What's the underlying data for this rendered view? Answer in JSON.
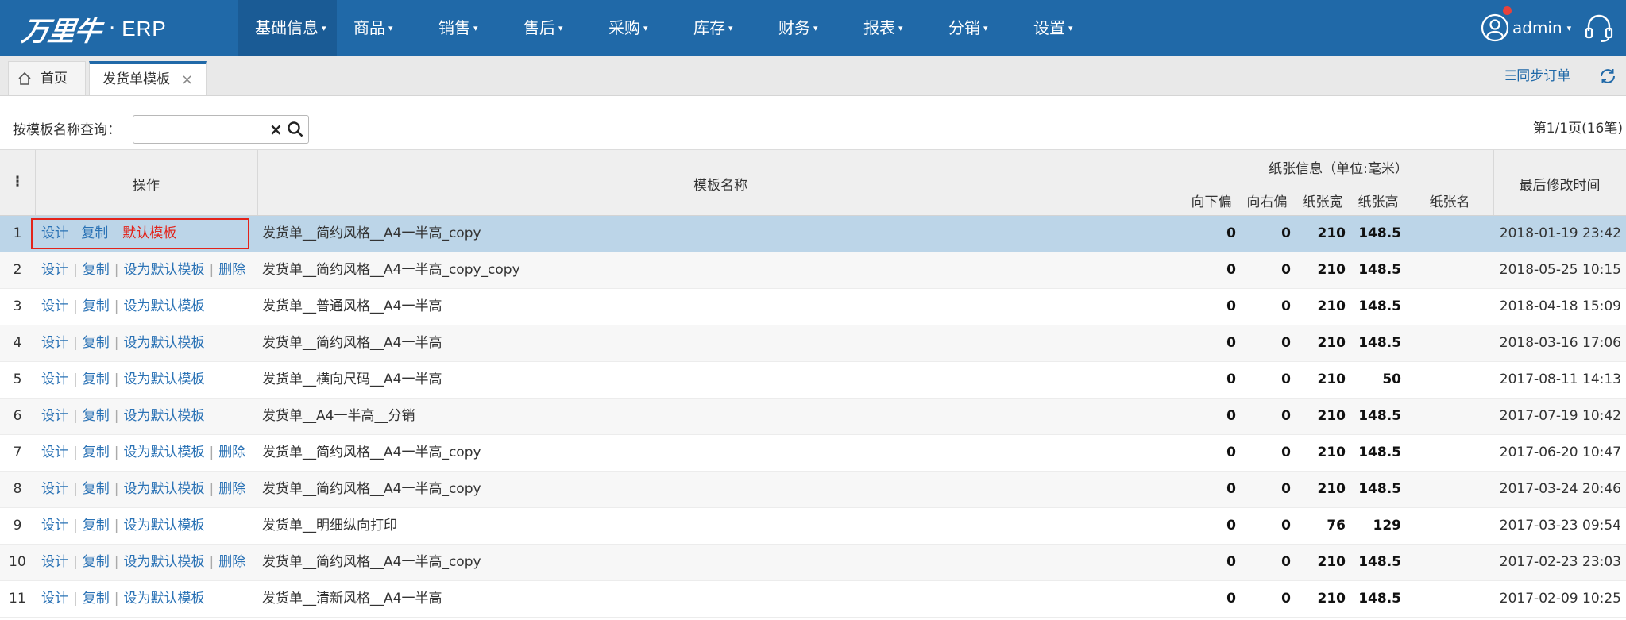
{
  "app": {
    "logo_text": "万里牛",
    "logo_dot": "·",
    "product": "ERP"
  },
  "nav": {
    "items": [
      {
        "label": "基础信息"
      },
      {
        "label": "商品"
      },
      {
        "label": "销售"
      },
      {
        "label": "售后"
      },
      {
        "label": "采购"
      },
      {
        "label": "库存"
      },
      {
        "label": "财务"
      },
      {
        "label": "报表"
      },
      {
        "label": "分销"
      },
      {
        "label": "设置"
      }
    ],
    "active_index": 0
  },
  "user": {
    "name": "admin",
    "icon": "user-circle-icon",
    "has_notification": true
  },
  "support_icon": "headset-icon",
  "tabs": {
    "home": {
      "label": "首页",
      "icon": "home-icon"
    },
    "active": {
      "label": "发货单模板",
      "close": "×"
    }
  },
  "toolbar": {
    "sync_label": "☰同步订单",
    "refresh_icon": "refresh-icon"
  },
  "search": {
    "label": "按模板名称查询：",
    "value": "",
    "placeholder": "",
    "clear": "×"
  },
  "pager": {
    "text": "第1/1页(16笔)"
  },
  "table": {
    "headers": {
      "menu": "⋮",
      "ops": "操作",
      "name": "模板名称",
      "paper_group": "纸张信息（单位:毫米）",
      "down_offset": "向下偏",
      "right_offset": "向右偏",
      "paper_width": "纸张宽",
      "paper_height": "纸张高",
      "paper_name": "纸张名",
      "modified": "最后修改时间"
    },
    "op_labels": {
      "design": "设计",
      "copy": "复制",
      "set_default": "设为默认模板",
      "default": "默认模板",
      "delete": "删除",
      "sep": "|"
    },
    "rows": [
      {
        "idx": "1",
        "name": "发货单__简约风格__A4一半高_copy",
        "down": "0",
        "right": "0",
        "w": "210",
        "h": "148.5",
        "time": "2018-01-19 23:42",
        "is_default": true,
        "deletable": false
      },
      {
        "idx": "2",
        "name": "发货单__简约风格__A4一半高_copy_copy",
        "down": "0",
        "right": "0",
        "w": "210",
        "h": "148.5",
        "time": "2018-05-25 10:15",
        "is_default": false,
        "deletable": true
      },
      {
        "idx": "3",
        "name": "发货单__普通风格__A4一半高",
        "down": "0",
        "right": "0",
        "w": "210",
        "h": "148.5",
        "time": "2018-04-18 15:09",
        "is_default": false,
        "deletable": false
      },
      {
        "idx": "4",
        "name": "发货单__简约风格__A4一半高",
        "down": "0",
        "right": "0",
        "w": "210",
        "h": "148.5",
        "time": "2018-03-16 17:06",
        "is_default": false,
        "deletable": false
      },
      {
        "idx": "5",
        "name": "发货单__横向尺码__A4一半高",
        "down": "0",
        "right": "0",
        "w": "210",
        "h": "50",
        "time": "2017-08-11 14:13",
        "is_default": false,
        "deletable": false
      },
      {
        "idx": "6",
        "name": "发货单__A4一半高__分销",
        "down": "0",
        "right": "0",
        "w": "210",
        "h": "148.5",
        "time": "2017-07-19 10:42",
        "is_default": false,
        "deletable": false
      },
      {
        "idx": "7",
        "name": "发货单__简约风格__A4一半高_copy",
        "down": "0",
        "right": "0",
        "w": "210",
        "h": "148.5",
        "time": "2017-06-20 10:47",
        "is_default": false,
        "deletable": true
      },
      {
        "idx": "8",
        "name": "发货单__简约风格__A4一半高_copy",
        "down": "0",
        "right": "0",
        "w": "210",
        "h": "148.5",
        "time": "2017-03-24 20:46",
        "is_default": false,
        "deletable": true
      },
      {
        "idx": "9",
        "name": "发货单__明细纵向打印",
        "down": "0",
        "right": "0",
        "w": "76",
        "h": "129",
        "time": "2017-03-23 09:54",
        "is_default": false,
        "deletable": false
      },
      {
        "idx": "10",
        "name": "发货单__简约风格__A4一半高_copy",
        "down": "0",
        "right": "0",
        "w": "210",
        "h": "148.5",
        "time": "2017-02-23 23:03",
        "is_default": false,
        "deletable": true
      },
      {
        "idx": "11",
        "name": "发货单__清新风格__A4一半高",
        "down": "0",
        "right": "0",
        "w": "210",
        "h": "148.5",
        "time": "2017-02-09 10:25",
        "is_default": false,
        "deletable": false
      }
    ],
    "selected_index": 0
  },
  "colors": {
    "nav_bg": "#2069a8",
    "nav_active": "#1a5b95",
    "link": "#2a72b5",
    "danger": "#e2231a",
    "selected_row": "#bcd5e8"
  }
}
